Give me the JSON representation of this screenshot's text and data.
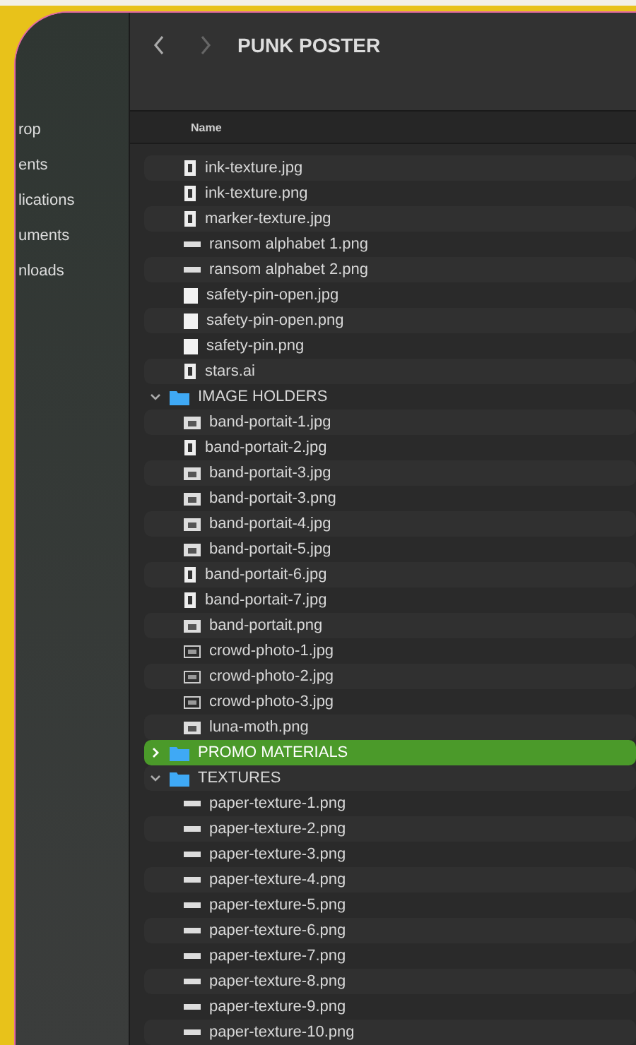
{
  "sidebar": {
    "items": [
      {
        "label": "rop"
      },
      {
        "label": "ents"
      },
      {
        "label": "lications"
      },
      {
        "label": "uments"
      },
      {
        "label": "nloads"
      }
    ]
  },
  "toolbar": {
    "title": "PUNK POSTER"
  },
  "list": {
    "column": "Name",
    "rows": [
      {
        "kind": "page",
        "name": "ink-texture.jpg",
        "selected": false
      },
      {
        "kind": "page",
        "name": "ink-texture.png",
        "selected": false
      },
      {
        "kind": "page",
        "name": "marker-texture.jpg",
        "selected": false
      },
      {
        "kind": "strip",
        "name": "ransom alphabet 1.png",
        "selected": false
      },
      {
        "kind": "strip",
        "name": "ransom alphabet 2.png",
        "selected": false
      },
      {
        "kind": "sheet",
        "name": "safety-pin-open.jpg",
        "selected": false
      },
      {
        "kind": "sheet",
        "name": "safety-pin-open.png",
        "selected": false
      },
      {
        "kind": "sheet",
        "name": "safety-pin.png",
        "selected": false
      },
      {
        "kind": "page",
        "name": "stars.ai",
        "selected": false
      },
      {
        "kind": "folder",
        "name": "IMAGE HOLDERS",
        "selected": false,
        "expanded": true,
        "children": [
          {
            "kind": "photo",
            "name": "band-portait-1.jpg",
            "selected": false
          },
          {
            "kind": "page",
            "name": "band-portait-2.jpg",
            "selected": false
          },
          {
            "kind": "photo",
            "name": "band-portait-3.jpg",
            "selected": false
          },
          {
            "kind": "photo",
            "name": "band-portait-3.png",
            "selected": false
          },
          {
            "kind": "photo",
            "name": "band-portait-4.jpg",
            "selected": false
          },
          {
            "kind": "photo",
            "name": "band-portait-5.jpg",
            "selected": false
          },
          {
            "kind": "page",
            "name": "band-portait-6.jpg",
            "selected": false
          },
          {
            "kind": "page",
            "name": "band-portait-7.jpg",
            "selected": false
          },
          {
            "kind": "photo",
            "name": "band-portait.png",
            "selected": false
          },
          {
            "kind": "frame",
            "name": "crowd-photo-1.jpg",
            "selected": false
          },
          {
            "kind": "frame",
            "name": "crowd-photo-2.jpg",
            "selected": false
          },
          {
            "kind": "frame",
            "name": "crowd-photo-3.jpg",
            "selected": false
          },
          {
            "kind": "photo",
            "name": "luna-moth.png",
            "selected": false
          }
        ]
      },
      {
        "kind": "folder",
        "name": "PROMO MATERIALS",
        "selected": true,
        "expanded": false,
        "children": []
      },
      {
        "kind": "folder",
        "name": "TEXTURES",
        "selected": false,
        "expanded": true,
        "children": [
          {
            "kind": "strip",
            "name": "paper-texture-1.png",
            "selected": false
          },
          {
            "kind": "strip",
            "name": "paper-texture-2.png",
            "selected": false
          },
          {
            "kind": "strip",
            "name": "paper-texture-3.png",
            "selected": false
          },
          {
            "kind": "strip",
            "name": "paper-texture-4.png",
            "selected": false
          },
          {
            "kind": "strip",
            "name": "paper-texture-5.png",
            "selected": false
          },
          {
            "kind": "strip",
            "name": "paper-texture-6.png",
            "selected": false
          },
          {
            "kind": "strip",
            "name": "paper-texture-7.png",
            "selected": false
          },
          {
            "kind": "strip",
            "name": "paper-texture-8.png",
            "selected": false
          },
          {
            "kind": "strip",
            "name": "paper-texture-9.png",
            "selected": false
          },
          {
            "kind": "strip",
            "name": "paper-texture-10.png",
            "selected": false
          }
        ]
      }
    ]
  }
}
